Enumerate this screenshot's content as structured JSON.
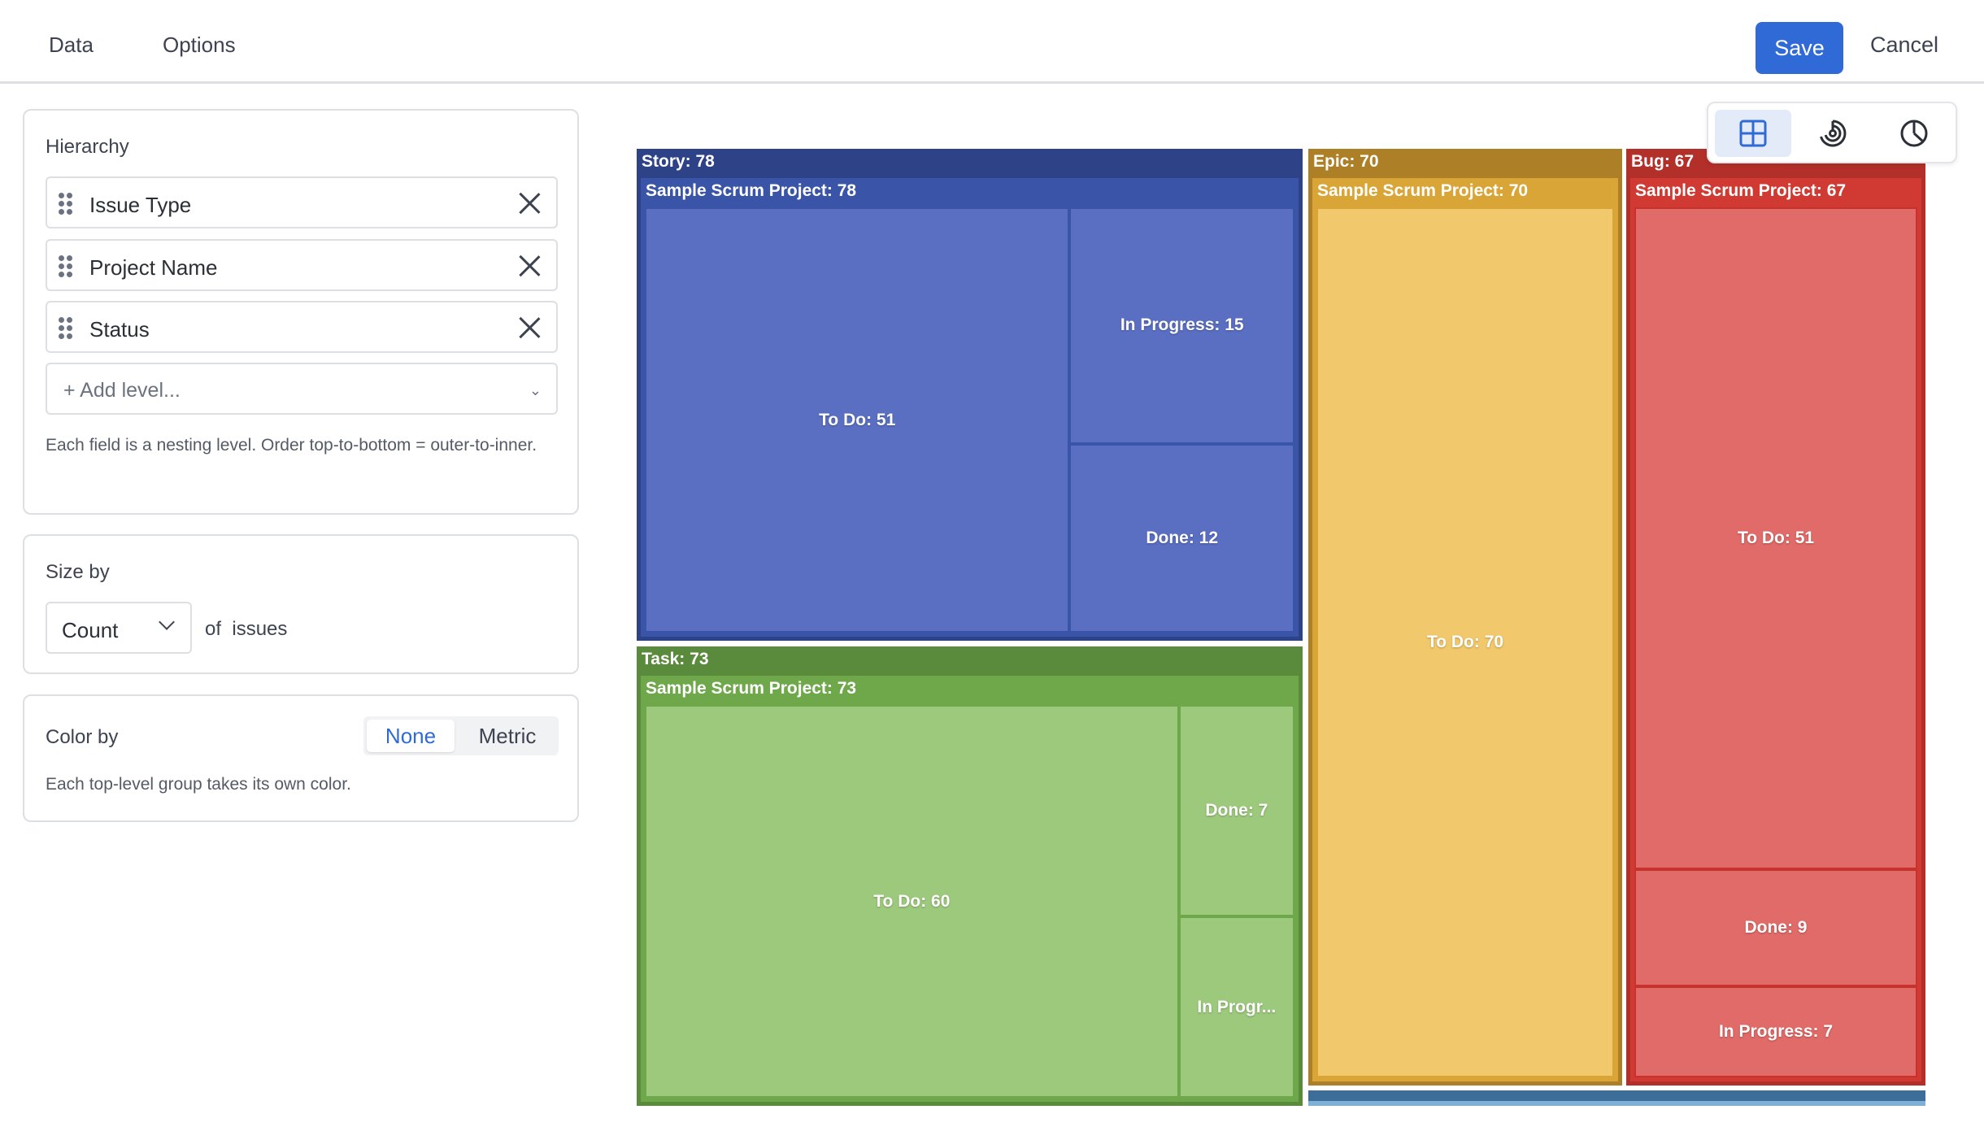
{
  "tabs": [
    {
      "label": "Data"
    },
    {
      "label": "Options"
    }
  ],
  "actions": {
    "save_label": "Save",
    "cancel_label": "Cancel"
  },
  "hierarchy": {
    "title": "Hierarchy",
    "levels": [
      {
        "label": "Issue Type",
        "icon": "drag-handle-icon"
      },
      {
        "label": "Project Name",
        "icon": "drag-handle-icon"
      },
      {
        "label": "Status",
        "icon": "drag-handle-icon"
      }
    ],
    "add_level_placeholder": "+ Add level...",
    "help": "Each field is a nesting level. Order top-to-bottom = outer-to-inner."
  },
  "size_by": {
    "title": "Size by",
    "selected": "Count",
    "of_label": "of",
    "unit": "issues"
  },
  "color_by": {
    "title": "Color by",
    "options": [
      "None",
      "Metric"
    ],
    "selected": "None",
    "help": "Each top-level group takes its own color."
  },
  "chart_types": [
    {
      "name": "treemap",
      "icon": "treemap-icon",
      "active": true
    },
    {
      "name": "sunburst",
      "icon": "sunburst-icon",
      "active": false
    },
    {
      "name": "pie",
      "icon": "pie-icon",
      "active": false
    }
  ],
  "chart_data": {
    "type": "treemap",
    "groups": [
      {
        "name": "Story",
        "value": 78,
        "label": "Story: 78",
        "color": "#2e4287",
        "project_color": "#3a54a8",
        "leaf_color": "#5a6fc2",
        "leaf_border": "#3a54a8",
        "project": {
          "name": "Sample Scrum Project",
          "value": 78,
          "label": "Sample Scrum Project: 78"
        },
        "children": [
          {
            "name": "To Do",
            "value": 51,
            "label": "To Do: 51"
          },
          {
            "name": "In Progress",
            "value": 15,
            "label": "In Progress: 15"
          },
          {
            "name": "Done",
            "value": 12,
            "label": "Done: 12"
          }
        ]
      },
      {
        "name": "Task",
        "value": 73,
        "label": "Task: 73",
        "color": "#5a8a3c",
        "project_color": "#6ea84a",
        "leaf_color": "#9dc97d",
        "leaf_border": "#6ea84a",
        "project": {
          "name": "Sample Scrum Project",
          "value": 73,
          "label": "Sample Scrum Project: 73"
        },
        "children": [
          {
            "name": "To Do",
            "value": 60,
            "label": "To Do: 60"
          },
          {
            "name": "Done",
            "value": 7,
            "label": "Done: 7"
          },
          {
            "name": "In Progress",
            "value": 6,
            "label": "In Progr..."
          }
        ]
      },
      {
        "name": "Epic",
        "value": 70,
        "label": "Epic: 70",
        "color": "#ad7f26",
        "project_color": "#d9a537",
        "leaf_color": "#f1c86b",
        "leaf_border": "#d9a537",
        "project": {
          "name": "Sample Scrum Project",
          "value": 70,
          "label": "Sample Scrum Project: 70"
        },
        "children": [
          {
            "name": "To Do",
            "value": 70,
            "label": "To Do: 70"
          }
        ]
      },
      {
        "name": "Bug",
        "value": 67,
        "label": "Bug: 67",
        "color": "#b32f2a",
        "project_color": "#d03a33",
        "leaf_color": "#e06b68",
        "leaf_border": "#c8322d",
        "project": {
          "name": "Sample Scrum Project",
          "value": 67,
          "label": "Sample Scrum Project: 67"
        },
        "children": [
          {
            "name": "To Do",
            "value": 51,
            "label": "To Do: 51"
          },
          {
            "name": "Done",
            "value": 9,
            "label": "Done: 9"
          },
          {
            "name": "In Progress",
            "value": 7,
            "label": "In Progress: 7"
          }
        ]
      }
    ],
    "extra_strip_color": "#3c6e99"
  }
}
